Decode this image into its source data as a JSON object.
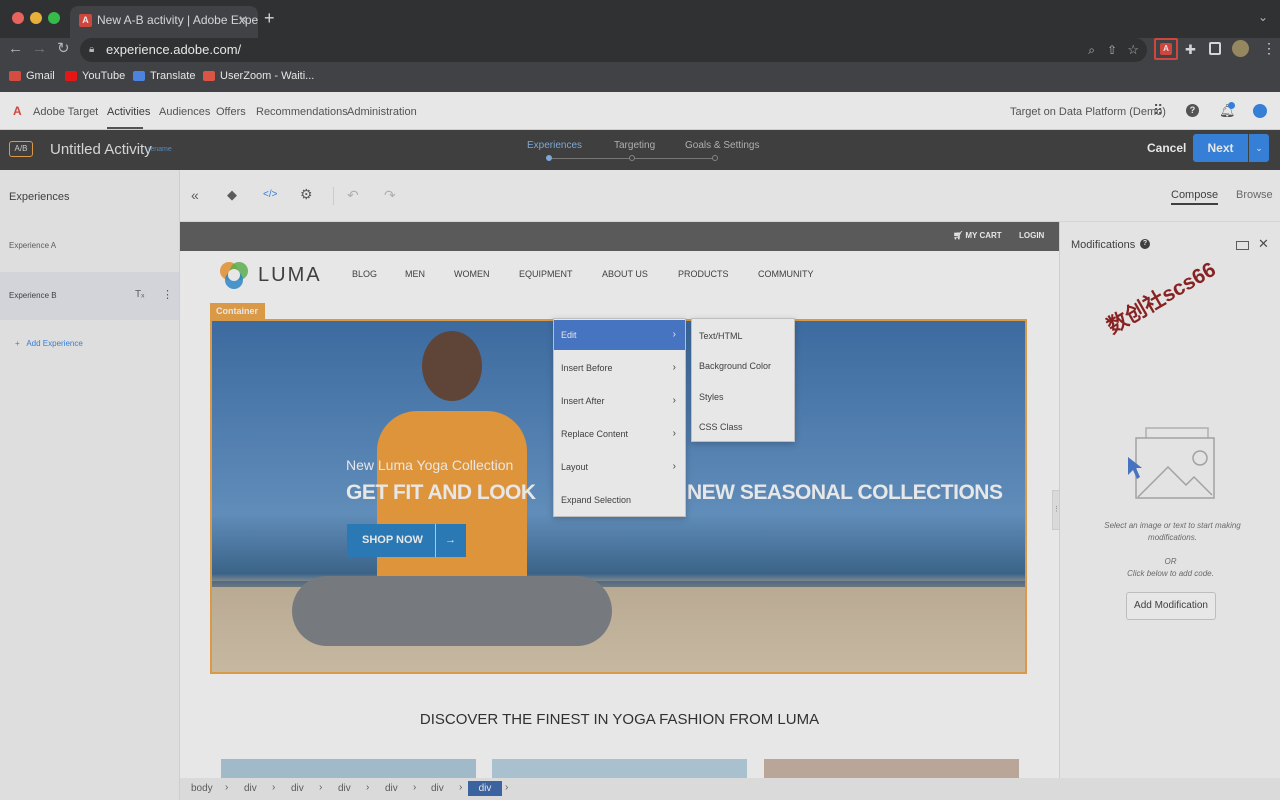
{
  "browser": {
    "tab_title": "New A-B activity | Adobe Expe",
    "url": "experience.adobe.com/",
    "bookmarks": [
      "Gmail",
      "YouTube",
      "Translate",
      "UserZoom - Waiti..."
    ]
  },
  "app": {
    "logo_text": "Adobe Target",
    "nav": [
      "Activities",
      "Audiences",
      "Offers",
      "Recommendations",
      "Administration"
    ],
    "workspace": "Target on Data Platform (Demo)"
  },
  "activity": {
    "badge": "A/B",
    "title": "Untitled Activity",
    "rename": "rename",
    "steps": [
      "Experiences",
      "Targeting",
      "Goals & Settings"
    ],
    "cancel": "Cancel",
    "next": "Next"
  },
  "left_panel": {
    "heading": "Experiences",
    "items": [
      "Experience A",
      "Experience B"
    ],
    "add": "Add Experience"
  },
  "toolbar": {
    "compose": "Compose",
    "browse": "Browse"
  },
  "site": {
    "cart": "MY CART",
    "login": "LOGIN",
    "logo": "LUMA",
    "nav": [
      "BLOG",
      "MEN",
      "WOMEN",
      "EQUIPMENT",
      "ABOUT US",
      "PRODUCTS",
      "COMMUNITY"
    ],
    "container_label": "Container",
    "hero_sub": "New Luma Yoga Collection",
    "hero_title_left": "GET FIT AND LOOK",
    "hero_title_right": "NEW SEASONAL COLLECTIONS",
    "shop_now": "SHOP NOW",
    "section_heading": "DISCOVER THE FINEST IN YOGA FASHION FROM LUMA"
  },
  "context_menu": {
    "items": [
      "Edit",
      "Insert Before",
      "Insert After",
      "Replace Content",
      "Layout",
      "Expand Selection"
    ],
    "submenu": [
      "Text/HTML",
      "Background Color",
      "Styles",
      "CSS Class"
    ]
  },
  "modifications": {
    "title": "Modifications",
    "hint": "Select an image or text to start making modifications.",
    "or": "OR",
    "hint2": "Click below to add code.",
    "button": "Add Modification",
    "watermark": "数创社scs66"
  },
  "breadcrumb": [
    "body",
    "div",
    "div",
    "div",
    "div",
    "div",
    "div"
  ],
  "colors": {
    "accent": "#2680eb",
    "selection": "#f0a03c",
    "chrome": "#202124"
  }
}
